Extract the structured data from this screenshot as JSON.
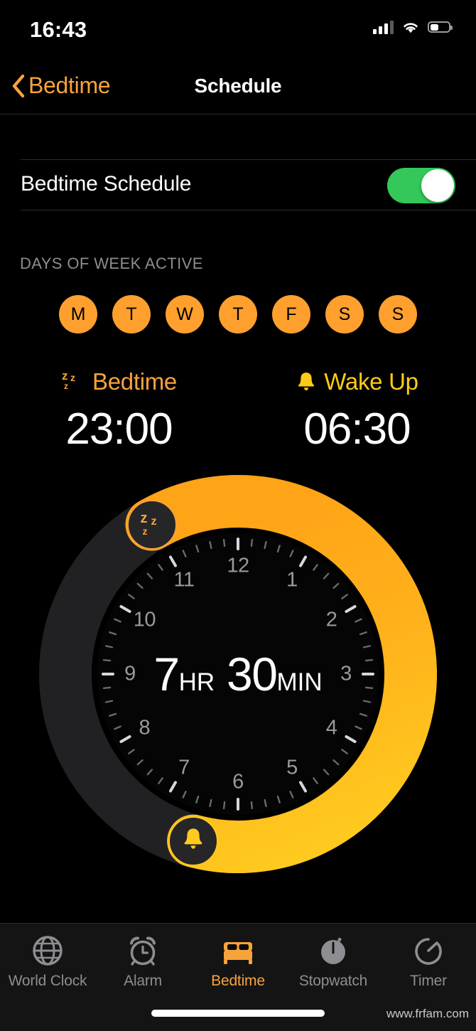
{
  "status_bar": {
    "time": "16:43",
    "signal_icon": "cellular-bars-icon",
    "wifi_icon": "wifi-icon",
    "battery_icon": "battery-icon",
    "battery_level_percent": 40,
    "signal_bars_filled": 3,
    "signal_bars_total": 4
  },
  "nav": {
    "back_label": "Bedtime",
    "back_icon": "chevron-left-icon",
    "title": "Schedule",
    "accent_color": "#F7A33C"
  },
  "schedule_toggle": {
    "label": "Bedtime Schedule",
    "enabled": true,
    "on_color": "#34C759"
  },
  "days": {
    "header": "DAYS OF WEEK ACTIVE",
    "active_color": "#FFA02E",
    "items": [
      {
        "letter": "M",
        "name": "monday",
        "active": true
      },
      {
        "letter": "T",
        "name": "tuesday",
        "active": true
      },
      {
        "letter": "W",
        "name": "wednesday",
        "active": true
      },
      {
        "letter": "T",
        "name": "thursday",
        "active": true
      },
      {
        "letter": "F",
        "name": "friday",
        "active": true
      },
      {
        "letter": "S",
        "name": "saturday",
        "active": true
      },
      {
        "letter": "S",
        "name": "sunday",
        "active": true
      }
    ]
  },
  "bedtime": {
    "label": "Bedtime",
    "time": "23:00",
    "icon": "zzz-icon",
    "color": "#F7A33C"
  },
  "wakeup": {
    "label": "Wake Up",
    "time": "06:30",
    "icon": "bell-icon",
    "color": "#FFCC15"
  },
  "clock": {
    "duration_hours": "7",
    "duration_hours_unit": "HR",
    "duration_minutes": "30",
    "duration_minutes_unit": "MIN",
    "hour_labels": [
      "12",
      "1",
      "2",
      "3",
      "4",
      "5",
      "6",
      "7",
      "8",
      "9",
      "10",
      "11"
    ],
    "bedtime_handle_hour": 11.0,
    "wakeup_handle_hour": 6.5,
    "arc_start_color": "#FFA317",
    "arc_end_color": "#FFCA1F",
    "track_color": "#212123",
    "face_color": "#050505"
  },
  "tabbar": {
    "items": [
      {
        "label": "World Clock",
        "icon": "globe-icon",
        "name": "world-clock",
        "active": false
      },
      {
        "label": "Alarm",
        "icon": "alarm-icon",
        "name": "alarm",
        "active": false
      },
      {
        "label": "Bedtime",
        "icon": "bed-icon",
        "name": "bedtime",
        "active": true
      },
      {
        "label": "Stopwatch",
        "icon": "stopwatch-icon",
        "name": "stopwatch",
        "active": false
      },
      {
        "label": "Timer",
        "icon": "timer-icon",
        "name": "timer",
        "active": false
      }
    ],
    "active_color": "#F7A33C"
  },
  "watermark": {
    "text": "www.frfam.com"
  }
}
